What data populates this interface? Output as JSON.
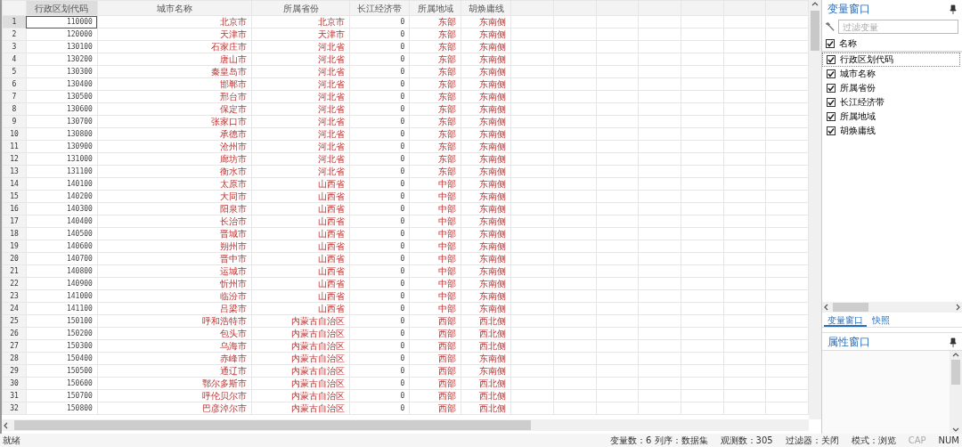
{
  "table": {
    "columns": [
      "行政区划代码",
      "城市名称",
      "所属省份",
      "长江经济带",
      "所属地域",
      "胡焕庸线"
    ],
    "rows": [
      {
        "number": "1",
        "selected": true,
        "cells": [
          "110000",
          "北京市",
          "北京市",
          "0",
          "东部",
          "东南侧"
        ]
      },
      {
        "number": "2",
        "selected": false,
        "cells": [
          "120000",
          "天津市",
          "天津市",
          "0",
          "东部",
          "东南侧"
        ]
      },
      {
        "number": "3",
        "selected": false,
        "cells": [
          "130100",
          "石家庄市",
          "河北省",
          "0",
          "东部",
          "东南侧"
        ]
      },
      {
        "number": "4",
        "selected": false,
        "cells": [
          "130200",
          "唐山市",
          "河北省",
          "0",
          "东部",
          "东南侧"
        ]
      },
      {
        "number": "5",
        "selected": false,
        "cells": [
          "130300",
          "秦皇岛市",
          "河北省",
          "0",
          "东部",
          "东南侧"
        ]
      },
      {
        "number": "6",
        "selected": false,
        "cells": [
          "130400",
          "邯郸市",
          "河北省",
          "0",
          "东部",
          "东南侧"
        ]
      },
      {
        "number": "7",
        "selected": false,
        "cells": [
          "130500",
          "邢台市",
          "河北省",
          "0",
          "东部",
          "东南侧"
        ]
      },
      {
        "number": "8",
        "selected": false,
        "cells": [
          "130600",
          "保定市",
          "河北省",
          "0",
          "东部",
          "东南侧"
        ]
      },
      {
        "number": "9",
        "selected": false,
        "cells": [
          "130700",
          "张家口市",
          "河北省",
          "0",
          "东部",
          "东南侧"
        ]
      },
      {
        "number": "10",
        "selected": false,
        "cells": [
          "130800",
          "承德市",
          "河北省",
          "0",
          "东部",
          "东南侧"
        ]
      },
      {
        "number": "11",
        "selected": false,
        "cells": [
          "130900",
          "沧州市",
          "河北省",
          "0",
          "东部",
          "东南侧"
        ]
      },
      {
        "number": "12",
        "selected": false,
        "cells": [
          "131000",
          "廊坊市",
          "河北省",
          "0",
          "东部",
          "东南侧"
        ]
      },
      {
        "number": "13",
        "selected": false,
        "cells": [
          "131100",
          "衡水市",
          "河北省",
          "0",
          "东部",
          "东南侧"
        ]
      },
      {
        "number": "14",
        "selected": false,
        "cells": [
          "140100",
          "太原市",
          "山西省",
          "0",
          "中部",
          "东南侧"
        ]
      },
      {
        "number": "15",
        "selected": false,
        "cells": [
          "140200",
          "大同市",
          "山西省",
          "0",
          "中部",
          "东南侧"
        ]
      },
      {
        "number": "16",
        "selected": false,
        "cells": [
          "140300",
          "阳泉市",
          "山西省",
          "0",
          "中部",
          "东南侧"
        ]
      },
      {
        "number": "17",
        "selected": false,
        "cells": [
          "140400",
          "长治市",
          "山西省",
          "0",
          "中部",
          "东南侧"
        ]
      },
      {
        "number": "18",
        "selected": false,
        "cells": [
          "140500",
          "晋城市",
          "山西省",
          "0",
          "中部",
          "东南侧"
        ]
      },
      {
        "number": "19",
        "selected": false,
        "cells": [
          "140600",
          "朔州市",
          "山西省",
          "0",
          "中部",
          "东南侧"
        ]
      },
      {
        "number": "20",
        "selected": false,
        "cells": [
          "140700",
          "晋中市",
          "山西省",
          "0",
          "中部",
          "东南侧"
        ]
      },
      {
        "number": "21",
        "selected": false,
        "cells": [
          "140800",
          "运城市",
          "山西省",
          "0",
          "中部",
          "东南侧"
        ]
      },
      {
        "number": "22",
        "selected": false,
        "cells": [
          "140900",
          "忻州市",
          "山西省",
          "0",
          "中部",
          "东南侧"
        ]
      },
      {
        "number": "23",
        "selected": false,
        "cells": [
          "141000",
          "临汾市",
          "山西省",
          "0",
          "中部",
          "东南侧"
        ]
      },
      {
        "number": "24",
        "selected": false,
        "cells": [
          "141100",
          "吕梁市",
          "山西省",
          "0",
          "中部",
          "东南侧"
        ]
      },
      {
        "number": "25",
        "selected": false,
        "cells": [
          "150100",
          "呼和浩特市",
          "内蒙古自治区",
          "0",
          "西部",
          "西北侧"
        ]
      },
      {
        "number": "26",
        "selected": false,
        "cells": [
          "150200",
          "包头市",
          "内蒙古自治区",
          "0",
          "西部",
          "西北侧"
        ]
      },
      {
        "number": "27",
        "selected": false,
        "cells": [
          "150300",
          "乌海市",
          "内蒙古自治区",
          "0",
          "西部",
          "西北侧"
        ]
      },
      {
        "number": "28",
        "selected": false,
        "cells": [
          "150400",
          "赤峰市",
          "内蒙古自治区",
          "0",
          "西部",
          "东南侧"
        ]
      },
      {
        "number": "29",
        "selected": false,
        "cells": [
          "150500",
          "通辽市",
          "内蒙古自治区",
          "0",
          "西部",
          "东南侧"
        ]
      },
      {
        "number": "30",
        "selected": false,
        "cells": [
          "150600",
          "鄂尔多斯市",
          "内蒙古自治区",
          "0",
          "西部",
          "西北侧"
        ]
      },
      {
        "number": "31",
        "selected": false,
        "cells": [
          "150700",
          "呼伦贝尔市",
          "内蒙古自治区",
          "0",
          "西部",
          "西北侧"
        ]
      },
      {
        "number": "32",
        "selected": false,
        "cells": [
          "150800",
          "巴彦淖尔市",
          "内蒙古自治区",
          "0",
          "西部",
          "西北侧"
        ]
      }
    ]
  },
  "variable_window": {
    "title": "变量窗口",
    "filter": {
      "placeholder": "过滤变量"
    },
    "header": {
      "label": "名称",
      "checked": true
    },
    "variables": [
      {
        "label": "行政区划代码",
        "checked": true,
        "selected": true
      },
      {
        "label": "城市名称",
        "checked": true,
        "selected": false
      },
      {
        "label": "所属省份",
        "checked": true,
        "selected": false
      },
      {
        "label": "长江经济带",
        "checked": true,
        "selected": false
      },
      {
        "label": "所属地域",
        "checked": true,
        "selected": false
      },
      {
        "label": "胡焕庸线",
        "checked": true,
        "selected": false
      }
    ],
    "tabs": [
      {
        "label": "变量窗口",
        "selected": true
      },
      {
        "label": "快照",
        "selected": false
      }
    ]
  },
  "property_window": {
    "title": "属性窗口"
  },
  "status_bar": {
    "message": "就绪",
    "items": [
      "变量数：6 列序：数据集",
      "观测数：305",
      "过滤器：关闭",
      "模式：浏览"
    ],
    "indicators": [
      {
        "label": "CAP",
        "on": false
      },
      {
        "label": "NUM",
        "on": true
      }
    ]
  }
}
